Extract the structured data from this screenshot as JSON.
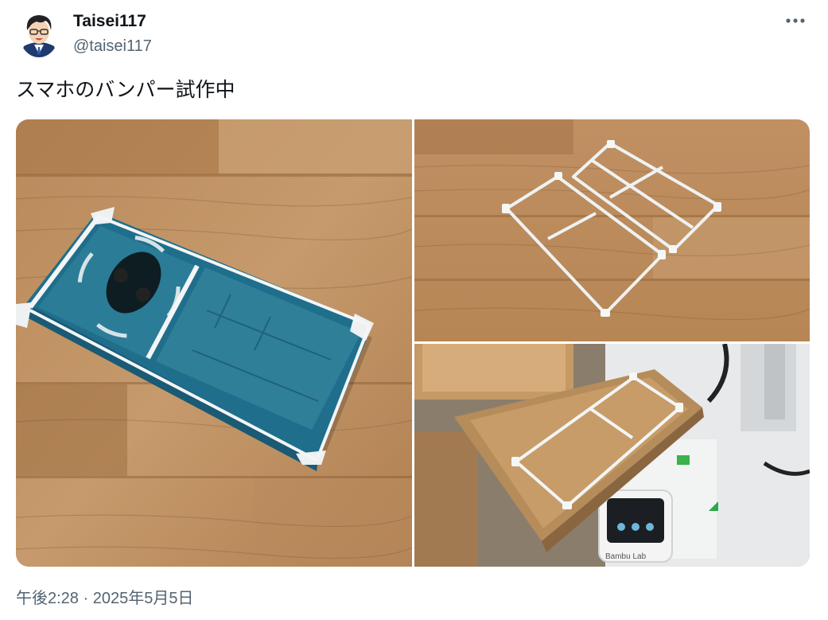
{
  "author": {
    "display_name": "Taisei117",
    "handle": "@taisei117",
    "avatar_icon": "avatar-illustration"
  },
  "tweet": {
    "text": "スマホのバンパー試作中",
    "timestamp": "午後2:28 · 2025年5月5日"
  },
  "actions": {
    "more_icon": "more-dots-icon"
  },
  "media": [
    {
      "name": "phone-with-bumper-on-wood"
    },
    {
      "name": "two-bumper-frames-on-wood"
    },
    {
      "name": "bumper-on-3d-printer-bed",
      "visible_labels": [
        "Bambu Lab"
      ]
    }
  ],
  "colors": {
    "text_primary": "#0f1419",
    "text_secondary": "#536471",
    "background": "#ffffff"
  }
}
